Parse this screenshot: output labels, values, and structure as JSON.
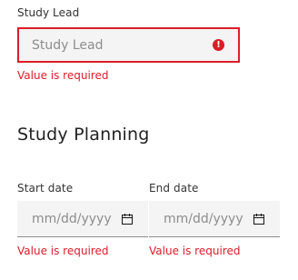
{
  "study_lead": {
    "label": "Study Lead",
    "placeholder": "Study Lead",
    "error": "Value is required"
  },
  "study_planning": {
    "title": "Study Planning",
    "start_date": {
      "label": "Start date",
      "placeholder": "mm/dd/yyyy",
      "error": "Value is required"
    },
    "end_date": {
      "label": "End date",
      "placeholder": "mm/dd/yyyy",
      "error": "Value is required"
    }
  },
  "colors": {
    "error": "#da1e28",
    "input_bg": "#f4f4f4",
    "label": "#333333",
    "placeholder": "#8d8d8d"
  },
  "icons": {
    "error": "error-circle-icon",
    "calendar": "calendar-icon"
  }
}
